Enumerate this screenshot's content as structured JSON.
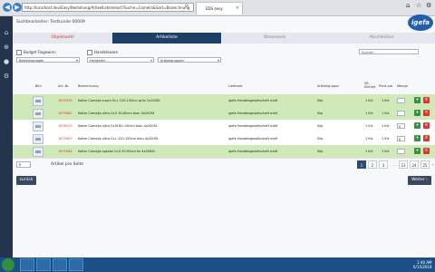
{
  "browser": {
    "url": "http://localhost.dev/Easy/Bestellung/Artikelliste/select?Suche=Comelia&Sort=Bezeichnung",
    "tab_title": "EDS easy",
    "back": "◀",
    "forward": "▶"
  },
  "page": {
    "title": "Suchbearbeiter: Testkunde 00009",
    "logo": "igefa",
    "steps": [
      {
        "label": "Objektwahl",
        "state": "done"
      },
      {
        "label": "Artikelliste",
        "state": "active"
      },
      {
        "label": "Warenkorb",
        "state": "todo"
      },
      {
        "label": "Abschließen",
        "state": "todo"
      }
    ]
  },
  "filters": {
    "budget_label": "Budget Fixgewinn",
    "handelsware_label": "Handelsware",
    "select1": "Bestellvorlagen",
    "select2": "Hersteller",
    "select3": "Artikelgruppen",
    "search_placeholder": "Suchen"
  },
  "table": {
    "headers": {
      "bild": "Bild",
      "artnr": "Art.-Nr.",
      "bez": "Bezeichnung",
      "lieferant": "Lieferant",
      "artgruppe": "Artikelgruppe",
      "einheit": "VE-Einheit",
      "preis": "Preis pro",
      "menge": "Menge"
    },
    "rows": [
      {
        "artnr": "1675926",
        "bez": "Kalter Comelja supra Gr.L 120-130cm grün 2x200St",
        "lieferant": "igefa Handelsgesellschaft mbH",
        "gruppe": "Slip",
        "einheit": "1 Krt",
        "preis": "1 Krt",
        "menge": "",
        "bg": "g"
      },
      {
        "artnr": "1675682",
        "bez": "Kalter Comelja ultra Gr.S 50-80cm blau 4x200St",
        "lieferant": "igefa Handelsgesellschaft mbH",
        "gruppe": "Slip",
        "einheit": "1 Krt",
        "preis": "1 Krt",
        "menge": "",
        "bg": "g"
      },
      {
        "artnr": "1676070",
        "bez": "Kalter Comelja ultra Gr.M 80-130cm blau 4x200St",
        "lieferant": "igefa Handelsgesellschaft mbH",
        "gruppe": "Slip",
        "einheit": "1 Krt",
        "preis": "1 Krt",
        "menge": "0",
        "bg": "w"
      },
      {
        "artnr": "1675983",
        "bez": "Kalter Comelja ultra Gr.L 120-150cm blau 4x200St",
        "lieferant": "igefa Handelsgesellschaft mbH",
        "gruppe": "Slip",
        "einheit": "1 Krt",
        "preis": "1 Krt",
        "menge": "0",
        "bg": "w"
      },
      {
        "artnr": "1675984",
        "bez": "Kalter Comelja spezial Gr.S 50-90cm fix 4x200St",
        "lieferant": "igefa Handelsgesellschaft mbH",
        "gruppe": "Slip",
        "einheit": "1 Krt",
        "preis": "1 Krt",
        "menge": "",
        "bg": "g"
      }
    ]
  },
  "pagination": {
    "per_page": "5",
    "per_page_label": "Artikel pro Seite",
    "pages": [
      "1",
      "2",
      "3",
      "...",
      "23",
      "24",
      "25"
    ],
    "active": "1",
    "prev": "‹",
    "next": "›"
  },
  "buttons": {
    "back": "zurück",
    "next": "Weiter ›"
  },
  "taskbar": {
    "time": "1:40 AM",
    "date": "6/15/2018"
  },
  "colors": {
    "sidebar": "#23344c",
    "step_active": "#1f3f66",
    "row_highlight": "#cfe9b8",
    "accent_red": "#d63a3a"
  }
}
